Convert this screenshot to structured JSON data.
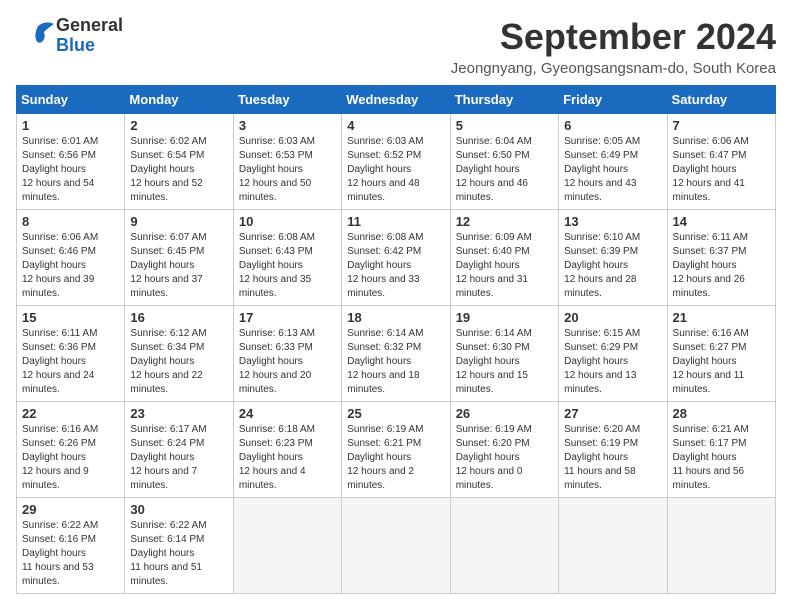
{
  "header": {
    "logo_line1": "General",
    "logo_line2": "Blue",
    "month_title": "September 2024",
    "subtitle": "Jeongnyang, Gyeongsangsnam-do, South Korea"
  },
  "weekdays": [
    "Sunday",
    "Monday",
    "Tuesday",
    "Wednesday",
    "Thursday",
    "Friday",
    "Saturday"
  ],
  "weeks": [
    [
      {
        "day": "1",
        "sunrise": "6:01 AM",
        "sunset": "6:56 PM",
        "daylight": "12 hours and 54 minutes."
      },
      {
        "day": "2",
        "sunrise": "6:02 AM",
        "sunset": "6:54 PM",
        "daylight": "12 hours and 52 minutes."
      },
      {
        "day": "3",
        "sunrise": "6:03 AM",
        "sunset": "6:53 PM",
        "daylight": "12 hours and 50 minutes."
      },
      {
        "day": "4",
        "sunrise": "6:03 AM",
        "sunset": "6:52 PM",
        "daylight": "12 hours and 48 minutes."
      },
      {
        "day": "5",
        "sunrise": "6:04 AM",
        "sunset": "6:50 PM",
        "daylight": "12 hours and 46 minutes."
      },
      {
        "day": "6",
        "sunrise": "6:05 AM",
        "sunset": "6:49 PM",
        "daylight": "12 hours and 43 minutes."
      },
      {
        "day": "7",
        "sunrise": "6:06 AM",
        "sunset": "6:47 PM",
        "daylight": "12 hours and 41 minutes."
      }
    ],
    [
      {
        "day": "8",
        "sunrise": "6:06 AM",
        "sunset": "6:46 PM",
        "daylight": "12 hours and 39 minutes."
      },
      {
        "day": "9",
        "sunrise": "6:07 AM",
        "sunset": "6:45 PM",
        "daylight": "12 hours and 37 minutes."
      },
      {
        "day": "10",
        "sunrise": "6:08 AM",
        "sunset": "6:43 PM",
        "daylight": "12 hours and 35 minutes."
      },
      {
        "day": "11",
        "sunrise": "6:08 AM",
        "sunset": "6:42 PM",
        "daylight": "12 hours and 33 minutes."
      },
      {
        "day": "12",
        "sunrise": "6:09 AM",
        "sunset": "6:40 PM",
        "daylight": "12 hours and 31 minutes."
      },
      {
        "day": "13",
        "sunrise": "6:10 AM",
        "sunset": "6:39 PM",
        "daylight": "12 hours and 28 minutes."
      },
      {
        "day": "14",
        "sunrise": "6:11 AM",
        "sunset": "6:37 PM",
        "daylight": "12 hours and 26 minutes."
      }
    ],
    [
      {
        "day": "15",
        "sunrise": "6:11 AM",
        "sunset": "6:36 PM",
        "daylight": "12 hours and 24 minutes."
      },
      {
        "day": "16",
        "sunrise": "6:12 AM",
        "sunset": "6:34 PM",
        "daylight": "12 hours and 22 minutes."
      },
      {
        "day": "17",
        "sunrise": "6:13 AM",
        "sunset": "6:33 PM",
        "daylight": "12 hours and 20 minutes."
      },
      {
        "day": "18",
        "sunrise": "6:14 AM",
        "sunset": "6:32 PM",
        "daylight": "12 hours and 18 minutes."
      },
      {
        "day": "19",
        "sunrise": "6:14 AM",
        "sunset": "6:30 PM",
        "daylight": "12 hours and 15 minutes."
      },
      {
        "day": "20",
        "sunrise": "6:15 AM",
        "sunset": "6:29 PM",
        "daylight": "12 hours and 13 minutes."
      },
      {
        "day": "21",
        "sunrise": "6:16 AM",
        "sunset": "6:27 PM",
        "daylight": "12 hours and 11 minutes."
      }
    ],
    [
      {
        "day": "22",
        "sunrise": "6:16 AM",
        "sunset": "6:26 PM",
        "daylight": "12 hours and 9 minutes."
      },
      {
        "day": "23",
        "sunrise": "6:17 AM",
        "sunset": "6:24 PM",
        "daylight": "12 hours and 7 minutes."
      },
      {
        "day": "24",
        "sunrise": "6:18 AM",
        "sunset": "6:23 PM",
        "daylight": "12 hours and 4 minutes."
      },
      {
        "day": "25",
        "sunrise": "6:19 AM",
        "sunset": "6:21 PM",
        "daylight": "12 hours and 2 minutes."
      },
      {
        "day": "26",
        "sunrise": "6:19 AM",
        "sunset": "6:20 PM",
        "daylight": "12 hours and 0 minutes."
      },
      {
        "day": "27",
        "sunrise": "6:20 AM",
        "sunset": "6:19 PM",
        "daylight": "11 hours and 58 minutes."
      },
      {
        "day": "28",
        "sunrise": "6:21 AM",
        "sunset": "6:17 PM",
        "daylight": "11 hours and 56 minutes."
      }
    ],
    [
      {
        "day": "29",
        "sunrise": "6:22 AM",
        "sunset": "6:16 PM",
        "daylight": "11 hours and 53 minutes."
      },
      {
        "day": "30",
        "sunrise": "6:22 AM",
        "sunset": "6:14 PM",
        "daylight": "11 hours and 51 minutes."
      },
      null,
      null,
      null,
      null,
      null
    ]
  ],
  "labels": {
    "sunrise": "Sunrise:",
    "sunset": "Sunset:",
    "daylight": "Daylight hours"
  }
}
